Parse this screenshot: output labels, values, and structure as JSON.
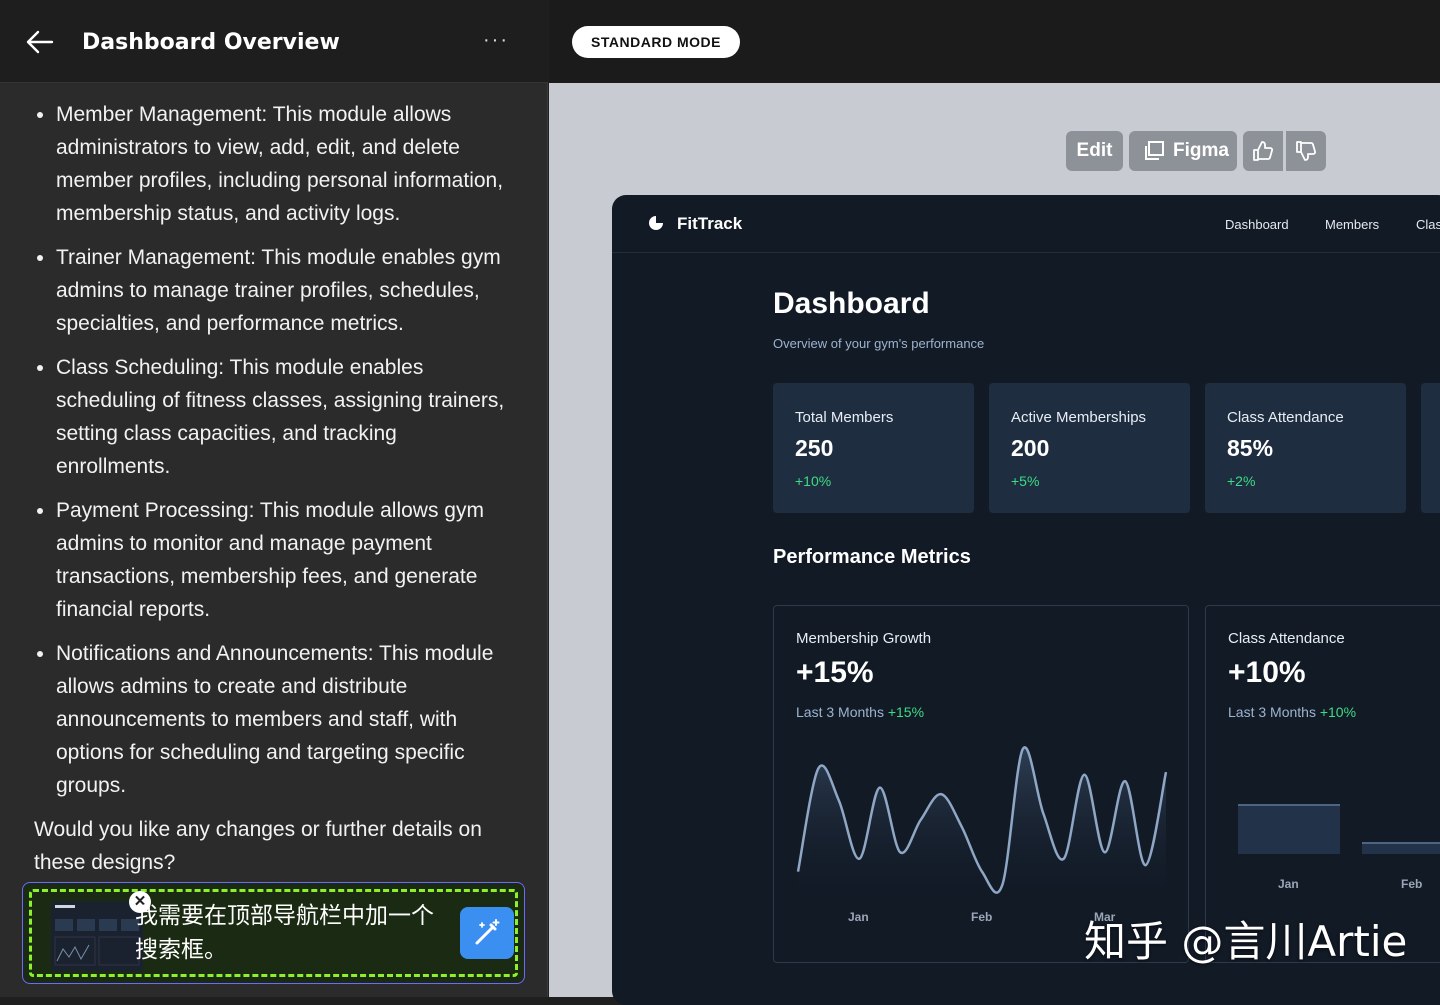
{
  "chat": {
    "title": "Dashboard Overview",
    "bullets": [
      "Member Management: This module allows administrators to view, add, edit, and delete member profiles, including personal information, membership status, and activity logs.",
      "Trainer Management: This module enables gym admins to manage trainer profiles, schedules, specialties, and performance metrics.",
      "Class Scheduling: This module enables scheduling of fitness classes, assigning trainers, setting class capacities, and tracking enrollments.",
      "Payment Processing: This module allows gym admins to monitor and manage payment transactions, membership fees, and generate financial reports.",
      "Notifications and Announcements: This module allows admins to create and distribute announcements to members and staff, with options for scheduling and targeting specific groups."
    ],
    "closing": "Would you like any changes or further details on these designs?",
    "composer_text": "我需要在顶部导航栏中加一个搜索框。"
  },
  "toolbar": {
    "mode": "STANDARD MODE",
    "edit": "Edit",
    "figma": "Figma"
  },
  "app": {
    "brand": "FitTrack",
    "nav": [
      "Dashboard",
      "Members",
      "Clas"
    ],
    "title": "Dashboard",
    "subtitle": "Overview of your gym's performance",
    "stats": [
      {
        "label": "Total Members",
        "value": "250",
        "change": "+10%"
      },
      {
        "label": "Active Memberships",
        "value": "200",
        "change": "+5%"
      },
      {
        "label": "Class Attendance",
        "value": "85%",
        "change": "+2%"
      }
    ],
    "section_title": "Performance Metrics",
    "charts": [
      {
        "title": "Membership Growth",
        "value": "+15%",
        "period": "Last 3 Months",
        "period_change": "+15%"
      },
      {
        "title": "Class Attendance",
        "value": "+10%",
        "period": "Last 3 Months",
        "period_change": "+10%"
      }
    ]
  },
  "chart_data": [
    {
      "type": "line",
      "title": "Membership Growth",
      "categories": [
        "Jan",
        "Feb",
        "Mar"
      ],
      "x": [
        0,
        0.5,
        1,
        1.5,
        2,
        2.5,
        3,
        3.5,
        4,
        4.5,
        5,
        5.5,
        6,
        6.5,
        7,
        7.5,
        8,
        8.5,
        9
      ],
      "values": [
        15,
        95,
        70,
        25,
        80,
        30,
        55,
        75,
        50,
        15,
        5,
        110,
        60,
        25,
        90,
        30,
        85,
        20,
        92
      ],
      "ylim": [
        0,
        120
      ]
    },
    {
      "type": "bar",
      "title": "Class Attendance",
      "categories": [
        "Jan",
        "Feb"
      ],
      "values": [
        50,
        12
      ],
      "ylim": [
        0,
        100
      ]
    }
  ],
  "watermark": "知乎 @言川Artie",
  "colors": {
    "accent": "#3b8ff0",
    "positive": "#3ddc84",
    "composer_border": "#8cf12a"
  }
}
